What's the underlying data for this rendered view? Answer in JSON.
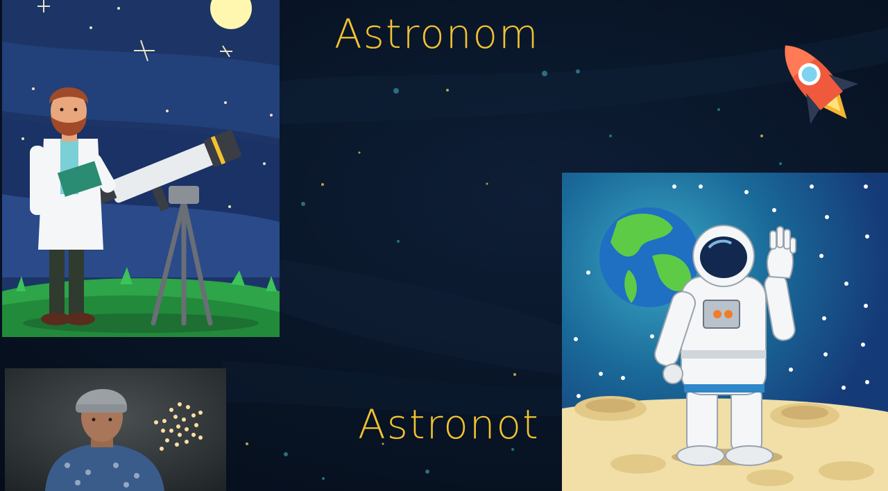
{
  "slide": {
    "title_top": "Astronom",
    "title_bottom": "Astronot"
  },
  "colors": {
    "background": "#081425",
    "title": "#f2c230",
    "rocket_body": "#ef5a3c"
  },
  "icons": {
    "rocket": "rocket-icon"
  }
}
